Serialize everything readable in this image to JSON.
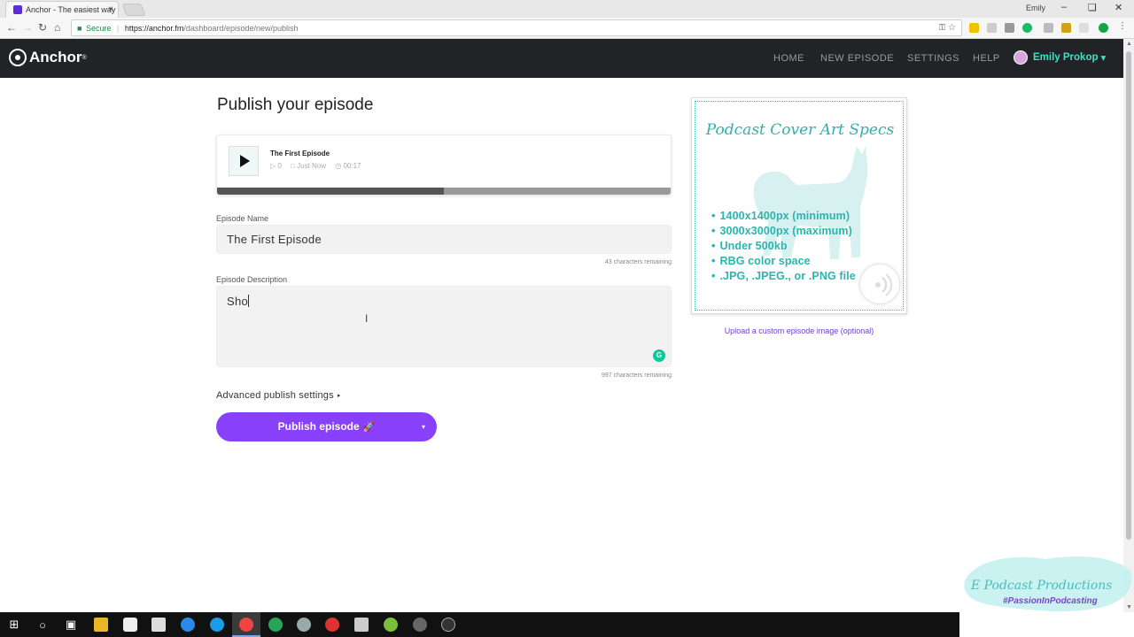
{
  "browser": {
    "tab_title": "Anchor - The easiest way",
    "tab_close": "×",
    "profile_name": "Emily",
    "window_controls": [
      "–",
      "❏",
      "✕"
    ],
    "nav": {
      "back": "←",
      "forward": "→",
      "reload": "↻",
      "home": "⌂"
    },
    "secure_label": "Secure",
    "url_host": "https://anchor.fm",
    "url_path": "/dashboard/episode/new/publish",
    "omnibox_icons": "⚿ ☆"
  },
  "appbar": {
    "brand": "Anchor",
    "brand_mark": "®",
    "nav": [
      "HOME",
      "NEW EPISODE",
      "SETTINGS",
      "HELP"
    ],
    "user_name": "Emily Prokop",
    "user_caret": "▾",
    "accent": "#3fe0c0"
  },
  "main": {
    "title": "Publish your episode",
    "player": {
      "episode_title": "The First Episode",
      "plays": "▷ 0",
      "date": "□ Just Now",
      "duration": "◷ 00:17",
      "progress": 0.5
    },
    "episode_name": {
      "label": "Episode Name",
      "value": "The First Episode",
      "remaining": "43 characters remaining"
    },
    "episode_description": {
      "label": "Episode Description",
      "value": "Sho",
      "remaining": "997 characters remaining",
      "grammarly": "G"
    },
    "advanced": {
      "label": "Advanced publish settings",
      "arrow": "▸"
    },
    "publish": {
      "label": "Publish episode",
      "rocket": "🚀",
      "caret": "▾",
      "color": "#8940fa"
    }
  },
  "cover": {
    "title": "Podcast Cover Art Specs",
    "specs": [
      "1400x1400px (minimum)",
      "3000x3000px (maximum)",
      "Under 500kb",
      "RBG color space",
      ".JPG, .JPEG., or .PNG file"
    ],
    "upload_link": "Upload a custom episode image (optional)",
    "color": "#2bb5b0"
  },
  "watermark": {
    "title": "E Podcast Productions",
    "tag": "#PassionInPodcasting"
  },
  "taskbar": {
    "icons": [
      "windows-icon",
      "search-icon",
      "task-view-icon",
      "file-explorer-icon",
      "camera-icon",
      "store-icon",
      "safari-icon",
      "mail-icon",
      "chrome-icon",
      "app-icon",
      "app-icon",
      "app-icon",
      "calculator-icon",
      "app-icon",
      "app-icon",
      "obs-icon"
    ]
  }
}
